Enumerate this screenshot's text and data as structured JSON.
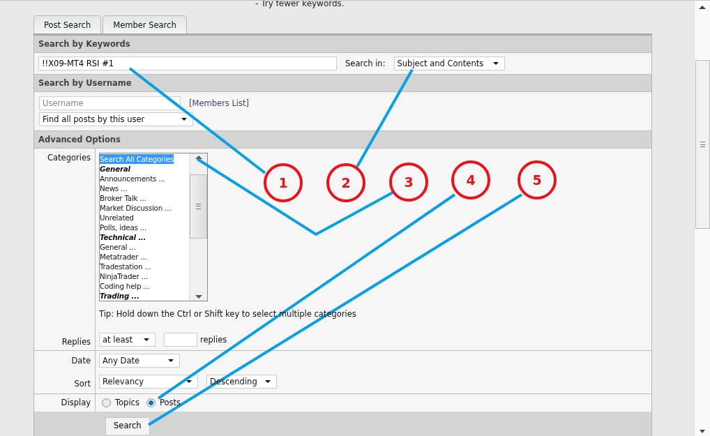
{
  "notice": "- Try fewer keywords.",
  "tabs": [
    {
      "label": "Post Search"
    },
    {
      "label": "Member Search"
    }
  ],
  "keywords": {
    "title": "Search by Keywords",
    "value": "!!X09-MT4 RSI #1",
    "search_in_label": "Search in:",
    "search_in": "Subject and Contents"
  },
  "username": {
    "title": "Search by Username",
    "placeholder": "Username",
    "members_link": "[Members List]",
    "mode": "Find all posts by this user"
  },
  "advanced": {
    "title": "Advanced Options",
    "categories_label": "Categories",
    "categories": [
      {
        "label": "Search All Categories",
        "kind": "item",
        "selected": true
      },
      {
        "label": "General",
        "kind": "group",
        "selected": false
      },
      {
        "label": "Announcements ...",
        "kind": "item",
        "selected": false
      },
      {
        "label": "News ...",
        "kind": "item",
        "selected": false
      },
      {
        "label": "Broker Talk ...",
        "kind": "item",
        "selected": false
      },
      {
        "label": "Market Discussion ...",
        "kind": "item",
        "selected": false
      },
      {
        "label": "Unrelated",
        "kind": "item",
        "selected": false
      },
      {
        "label": "Polls, ideas ...",
        "kind": "item",
        "selected": false
      },
      {
        "label": "Technical ...",
        "kind": "group",
        "selected": false
      },
      {
        "label": "General ...",
        "kind": "item",
        "selected": false
      },
      {
        "label": "Metatrader ...",
        "kind": "item",
        "selected": false
      },
      {
        "label": "Tradestation ...",
        "kind": "item",
        "selected": false
      },
      {
        "label": "NinjaTrader ...",
        "kind": "item",
        "selected": false
      },
      {
        "label": "Coding help ...",
        "kind": "item",
        "selected": false
      },
      {
        "label": "Trading ...",
        "kind": "group",
        "selected": false
      }
    ],
    "tip": "Tip: Hold down the Ctrl or Shift key to select multiple categories",
    "replies_label": "Replies",
    "replies_mode": "at least",
    "replies_unit": "replies",
    "date_label": "Date",
    "date": "Any Date",
    "sort_label": "Sort",
    "sort_by": "Relevancy",
    "sort_order": "Descending",
    "display_label": "Display",
    "display_options": [
      {
        "label": "Topics",
        "selected": false
      },
      {
        "label": "Posts",
        "selected": true
      }
    ]
  },
  "search_button": "Search",
  "callouts": [
    {
      "number": "1"
    },
    {
      "number": "2"
    },
    {
      "number": "3"
    },
    {
      "number": "4"
    },
    {
      "number": "5"
    }
  ]
}
